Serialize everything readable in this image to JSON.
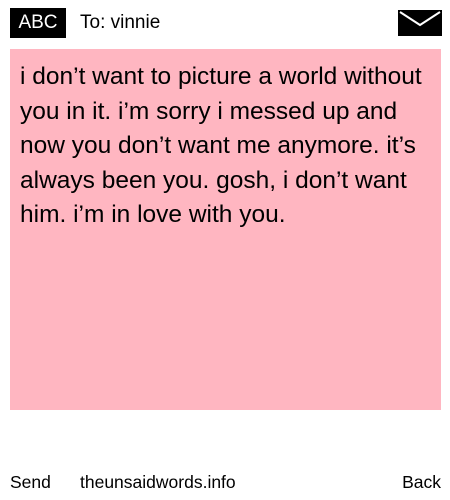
{
  "header": {
    "mode_label": "ABC",
    "recipient": "To: vinnie",
    "mail_icon": "envelope-icon"
  },
  "message": {
    "text": "i don’t want to picture a world without you in it. i’m sorry i messed up and now you don’t want me anymore. it’s always been you. gosh, i don’t want him. i’m in love with you."
  },
  "footer": {
    "send_label": "Send",
    "site_label": "theunsaidwords.info",
    "back_label": "Back"
  },
  "colors": {
    "message_background": "#ffb6c1",
    "badge_background": "#000000",
    "badge_text": "#ffffff"
  }
}
